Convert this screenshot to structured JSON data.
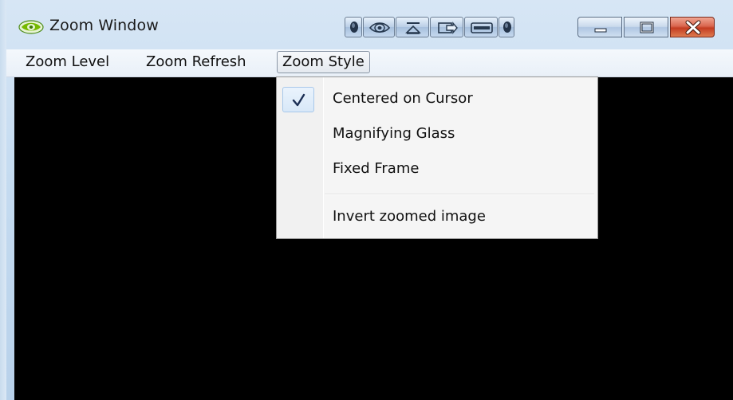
{
  "window": {
    "title": "Zoom Window",
    "icon": "nvidia-logo-icon"
  },
  "titlebar_tools": [
    {
      "icon": "dot-icon"
    },
    {
      "icon": "nvidia-eye-icon"
    },
    {
      "icon": "restore-down-icon"
    },
    {
      "icon": "arrow-right-icon"
    },
    {
      "icon": "bar-icon"
    },
    {
      "icon": "dot-icon"
    }
  ],
  "caption_buttons": {
    "minimize": "minimize-icon",
    "maximize": "maximize-icon",
    "close": "close-icon"
  },
  "menubar": {
    "items": [
      {
        "label": "Zoom Level"
      },
      {
        "label": "Zoom Refresh"
      },
      {
        "label": "Zoom Style",
        "open": true
      }
    ]
  },
  "dropdown": {
    "items": [
      {
        "label": "Centered on Cursor",
        "checked": true
      },
      {
        "label": "Magnifying Glass",
        "checked": false
      },
      {
        "label": "Fixed Frame",
        "checked": false
      },
      {
        "label": "Invert zoomed image",
        "checked": false
      }
    ]
  },
  "colors": {
    "content_background": "#000000",
    "close_button": "#c43d22",
    "check_highlight": "#d8e8f8"
  }
}
